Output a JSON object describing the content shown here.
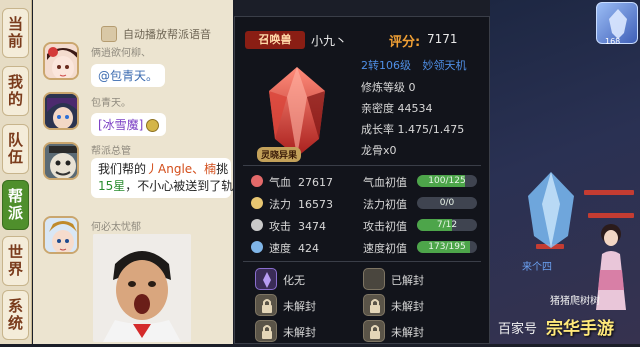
{
  "tabs": [
    {
      "label": "当前",
      "active": false
    },
    {
      "label": "我的",
      "active": false
    },
    {
      "label": "队伍",
      "active": false
    },
    {
      "label": "帮派",
      "active": true
    },
    {
      "label": "世界",
      "active": false
    },
    {
      "label": "系统",
      "active": false
    }
  ],
  "chat": {
    "auto_play_label": "自动播放帮派语音",
    "messages": [
      {
        "name": "俩逍欲何柳、",
        "text": "@包青天。"
      },
      {
        "name": "包青天。",
        "text": "[冰雪魔]"
      },
      {
        "name": "帮派总管",
        "line1_prefix": "我们帮的",
        "line1_highlight": "丿Angle、楠",
        "line1_suffix": "挑",
        "line2_green": "15星",
        "line2_text": "，不小心被送到了轨"
      },
      {
        "name": "何必太忧郁"
      }
    ]
  },
  "pet_panel": {
    "badge": "召唤兽",
    "name": "小九丶",
    "score_label": "评分:",
    "score": "7171",
    "reincarnation": "2转106级",
    "species": "妙领天机",
    "pet_tag": "灵晓异果",
    "info": [
      {
        "label": "修炼等级",
        "value": "0"
      },
      {
        "label": "亲密度",
        "value": "44534"
      },
      {
        "label": "成长率",
        "value": "1.475/1.475"
      },
      {
        "label": "龙骨",
        "value": "x0"
      }
    ],
    "stats": [
      {
        "label": "气血",
        "value": "27617",
        "aptitude_label": "气血初值",
        "aptitude": "100/125",
        "fill": 0.8,
        "icon": "heart-icon"
      },
      {
        "label": "法力",
        "value": "16573",
        "aptitude_label": "法力初值",
        "aptitude": "0/0",
        "fill": 0,
        "icon": "mana-icon"
      },
      {
        "label": "攻击",
        "value": "3474",
        "aptitude_label": "攻击初值",
        "aptitude": "7/12",
        "fill": 0.583,
        "icon": "sword-icon"
      },
      {
        "label": "速度",
        "value": "424",
        "aptitude_label": "速度初值",
        "aptitude": "173/195",
        "fill": 0.887,
        "icon": "speed-icon"
      }
    ],
    "skills": [
      {
        "label": "化无",
        "icon": "skill-icon",
        "locked": false
      },
      {
        "label": "已解封",
        "icon": "skill-slot-icon",
        "locked": false
      },
      {
        "label": "未解封",
        "icon": "lock-icon",
        "locked": true
      },
      {
        "label": "未解封",
        "icon": "lock-icon",
        "locked": true
      },
      {
        "label": "未解封",
        "icon": "lock-icon",
        "locked": true
      },
      {
        "label": "未解封",
        "icon": "lock-icon",
        "locked": true
      }
    ]
  },
  "scene": {
    "corner_value": "168",
    "labels": [
      "来个四",
      "猪猪爬树树"
    ],
    "watermark_text": "百家号",
    "watermark_logo": "宗华手游"
  },
  "colors": {
    "active_tab": "#4f8f2c",
    "score": "#f0a035",
    "bar_fill": "#4da54a",
    "link_blue": "#3b6bb0"
  }
}
